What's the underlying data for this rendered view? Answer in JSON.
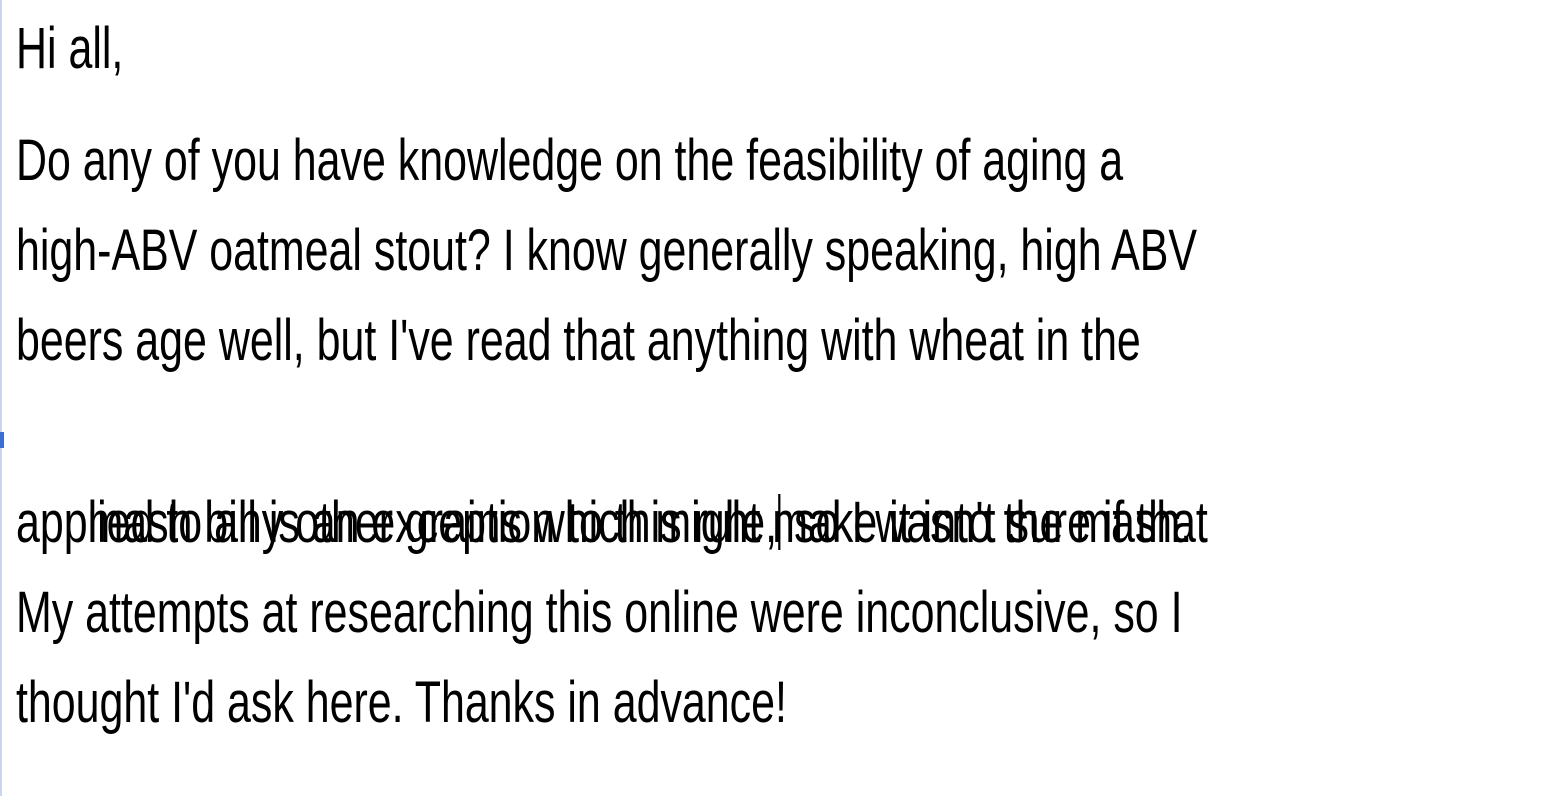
{
  "document": {
    "greeting": "Hi all,",
    "body_lines": [
      "Do any of you have knowledge on the feasibility of aging a",
      "high-ABV oatmeal stout? I know generally speaking, high ABV",
      "beers age well, but I've read that anything with wheat in the",
      "mash bill is an exception to this rule,",
      " so I wasn't sure if that",
      "applied to any other grains which might make it into the mash.",
      "My attempts at researching this online were inconclusive, so I",
      "thought I'd ask here. Thanks in advance!"
    ]
  }
}
